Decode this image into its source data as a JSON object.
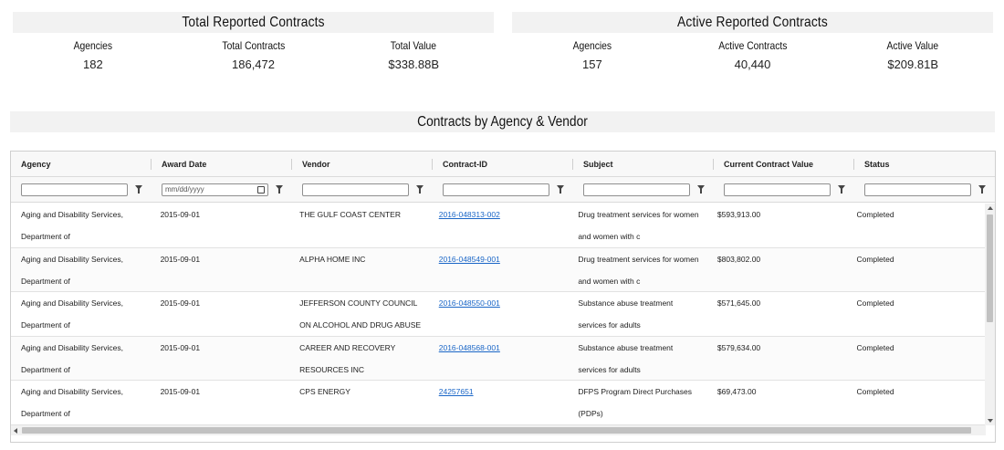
{
  "kpi_total": {
    "title": "Total Reported Contracts",
    "metrics": [
      {
        "label": "Agencies",
        "value": "182"
      },
      {
        "label": "Total Contracts",
        "value": "186,472"
      },
      {
        "label": "Total Value",
        "value": "$338.88B"
      }
    ]
  },
  "kpi_active": {
    "title": "Active Reported Contracts",
    "metrics": [
      {
        "label": "Agencies",
        "value": "157"
      },
      {
        "label": "Active Contracts",
        "value": "40,440"
      },
      {
        "label": "Active Value",
        "value": "$209.81B"
      }
    ]
  },
  "grid": {
    "title": "Contracts by Agency & Vendor",
    "columns": [
      "Agency",
      "Award Date",
      "Vendor",
      "Contract-ID",
      "Subject",
      "Current Contract Value",
      "Status"
    ],
    "date_placeholder": "mm/dd/yyyy",
    "rows": [
      {
        "agency": "Aging and Disability Services, Department of",
        "award_date": "2015-09-01",
        "vendor": "THE GULF COAST CENTER",
        "contract_id": "2016-048313-002",
        "subject": "Drug treatment services for women and women with c",
        "value": "$593,913.00",
        "status": "Completed"
      },
      {
        "agency": "Aging and Disability Services, Department of",
        "award_date": "2015-09-01",
        "vendor": "ALPHA HOME INC",
        "contract_id": "2016-048549-001",
        "subject": "Drug treatment services for women and women with c",
        "value": "$803,802.00",
        "status": "Completed"
      },
      {
        "agency": "Aging and Disability Services, Department of",
        "award_date": "2015-09-01",
        "vendor": "JEFFERSON COUNTY COUNCIL ON ALCOHOL AND DRUG ABUSE",
        "contract_id": "2016-048550-001",
        "subject": "Substance abuse treatment services for adults",
        "value": "$571,645.00",
        "status": "Completed"
      },
      {
        "agency": "Aging and Disability Services, Department of",
        "award_date": "2015-09-01",
        "vendor": "CAREER AND RECOVERY RESOURCES INC",
        "contract_id": "2016-048568-001",
        "subject": "Substance abuse treatment services for adults",
        "value": "$579,634.00",
        "status": "Completed"
      },
      {
        "agency": "Aging and Disability Services, Department of",
        "award_date": "2015-09-01",
        "vendor": "CPS ENERGY",
        "contract_id": "24257651",
        "subject": "DFPS Program Direct Purchases (PDPs)",
        "value": "$69,473.00",
        "status": "Completed"
      }
    ]
  }
}
